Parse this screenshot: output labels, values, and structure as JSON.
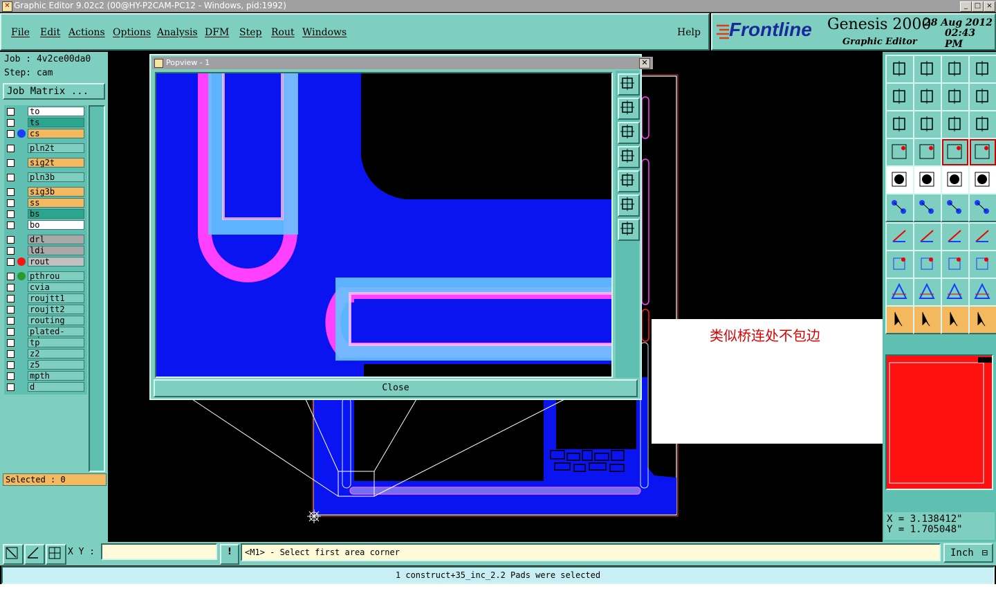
{
  "window": {
    "title": "Graphic Editor 9.02c2 (00@HY-P2CAM-PC12 - Windows, pid:1992)",
    "controls": [
      "_",
      "□",
      "×"
    ]
  },
  "menu": {
    "items": [
      "File",
      "Edit",
      "Actions",
      "Options",
      "Analysis",
      "DFM",
      "Step",
      "Rout",
      "Windows"
    ],
    "help": "Help"
  },
  "logo": {
    "brand": "Frontline",
    "product": "Genesis 2000",
    "subtitle": "Graphic Editor",
    "date": "28 Aug 2012",
    "time": "02:43 PM"
  },
  "job": {
    "job_label": "Job : 4v2ce00da0",
    "step_label": "Step: cam",
    "job_matrix_button": "Job Matrix ..."
  },
  "layers": [
    {
      "name": "to",
      "color": "#ffffff",
      "dot": ""
    },
    {
      "name": "ts",
      "color": "#2aa68e",
      "dot": ""
    },
    {
      "name": "cs",
      "color": "#f4b85e",
      "dot": "#1a3cff"
    },
    {
      "name": "pln2t",
      "color": "#7ecfc0",
      "dot": ""
    },
    {
      "name": "sig2t",
      "color": "#f4b85e",
      "dot": ""
    },
    {
      "name": "pln3b",
      "color": "#7ecfc0",
      "dot": ""
    },
    {
      "name": "sig3b",
      "color": "#f4b85e",
      "dot": ""
    },
    {
      "name": "ss",
      "color": "#f4b85e",
      "dot": ""
    },
    {
      "name": "bs",
      "color": "#2aa68e",
      "dot": ""
    },
    {
      "name": "bo",
      "color": "#ffffff",
      "dot": ""
    },
    {
      "name": "drl",
      "color": "#a8a8a8",
      "dot": ""
    },
    {
      "name": "ldi",
      "color": "#a8a8a8",
      "dot": ""
    },
    {
      "name": "rout",
      "color": "#c0c0c0",
      "dot": "#ff1010"
    },
    {
      "name": "pthrou",
      "color": "#7ecfc0",
      "dot": "#2a9a2a"
    },
    {
      "name": "cvia",
      "color": "#7ecfc0",
      "dot": ""
    },
    {
      "name": "roujtt1",
      "color": "#7ecfc0",
      "dot": ""
    },
    {
      "name": "roujtt2",
      "color": "#7ecfc0",
      "dot": ""
    },
    {
      "name": "routing",
      "color": "#7ecfc0",
      "dot": ""
    },
    {
      "name": "plated-edge",
      "color": "#7ecfc0",
      "dot": ""
    },
    {
      "name": "tp",
      "color": "#7ecfc0",
      "dot": ""
    },
    {
      "name": "z2",
      "color": "#7ecfc0",
      "dot": ""
    },
    {
      "name": "z5",
      "color": "#7ecfc0",
      "dot": ""
    },
    {
      "name": "mpth",
      "color": "#7ecfc0",
      "dot": ""
    },
    {
      "name": "d",
      "color": "#7ecfc0",
      "dot": ""
    }
  ],
  "selected_label": "Selected : 0",
  "popview": {
    "title": "Popview - 1",
    "close_button": "Close"
  },
  "annotation": {
    "text": "类似桥连处不包边"
  },
  "coords": {
    "x": "X = 3.138412\"",
    "y": "Y = 1.705048\""
  },
  "bottom": {
    "xy_label": "X Y :",
    "xy_value": "",
    "prompt": "<M1> - Select first area corner",
    "unit": "Inch",
    "status": "1 construct+35_inc_2.2 Pads were selected"
  },
  "colors": {
    "panel": "#7ecfc0",
    "panel_dark": "#5fbfb0",
    "board_blue": "#0a14f0",
    "magenta": "#ff40ff",
    "light_blue": "#57b8ff",
    "selected_bg": "#f4b85e"
  }
}
